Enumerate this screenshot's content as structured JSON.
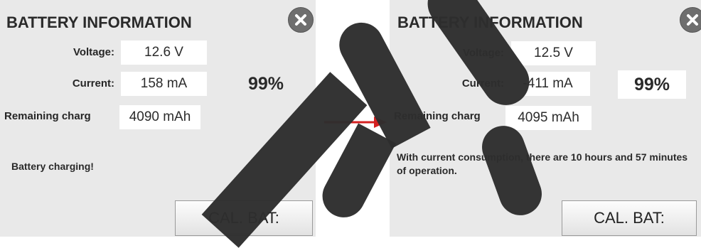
{
  "left_panel": {
    "title": "BATTERY INFORMATION",
    "voltage_label": "Voltage:",
    "voltage_value": "12.6 V",
    "current_label": "Current:",
    "current_value": "158 mA",
    "remaining_label": "Remaining charg",
    "remaining_value": "4090 mAh",
    "percent": "99%",
    "status": "Battery charging!",
    "cal_button": "CAL. BAT:"
  },
  "right_panel": {
    "title": "BATTERY INFORMATION",
    "voltage_label": "Voltage:",
    "voltage_value": "12.5 V",
    "current_label": "Current:",
    "current_value": "-411 mA",
    "remaining_label": "Remaining charg",
    "remaining_value": "4095 mAh",
    "percent": "99%",
    "status": "With current consumption, there are 10 hours and 57 minutes of operation.",
    "cal_button": "CAL. BAT:"
  },
  "colors": {
    "panel_bg": "#e9e9e9",
    "arrow": "#d42020",
    "watermark": "#2d2d2d"
  },
  "icons": {
    "close": "close-icon",
    "arrow": "arrow-right-icon"
  }
}
